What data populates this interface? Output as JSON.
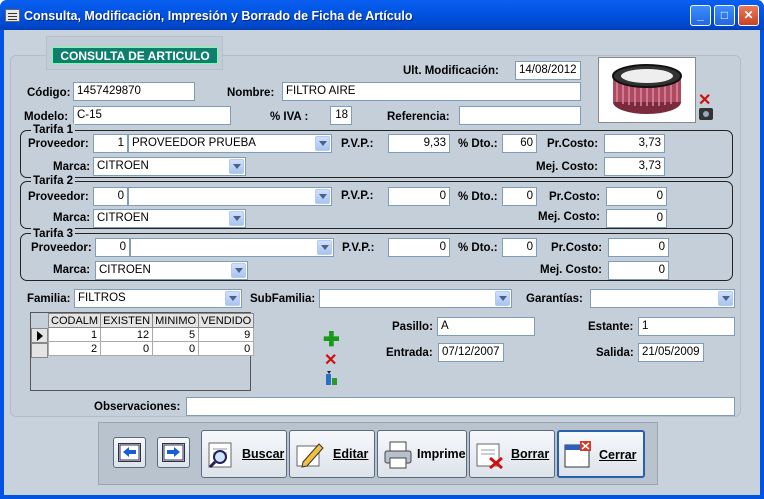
{
  "window": {
    "title": "Consulta, Modificación, Impresión y Borrado de Ficha de Artículo",
    "minimize": "_",
    "maximize": "□",
    "close": "✕"
  },
  "tab": {
    "label": "CONSULTA DE ARTICULO"
  },
  "header": {
    "ult_mod_label": "Ult. Modificación:",
    "ult_mod_value": "14/08/2012",
    "codigo_label": "Código:",
    "codigo_value": "1457429870",
    "nombre_label": "Nombre:",
    "nombre_value": "FILTRO AIRE",
    "modelo_label": "Modelo:",
    "modelo_value": "C-15",
    "iva_label": "% IVA :",
    "iva_value": "18",
    "referencia_label": "Referencia:",
    "referencia_value": ""
  },
  "labels": {
    "proveedor": "Proveedor:",
    "pvp": "P.V.P.:",
    "dto": "% Dto.:",
    "prcosto": "Pr.Costo:",
    "marca": "Marca:",
    "mejcosto": "Mej. Costo:"
  },
  "tarifas": [
    {
      "title": "Tarifa 1",
      "prov_num": "1",
      "prov_name": "PROVEEDOR PRUEBA",
      "pvp": "9,33",
      "dto": "60",
      "prcosto": "3,73",
      "marca": "CITROEN",
      "mejcosto": "3,73"
    },
    {
      "title": "Tarifa 2",
      "prov_num": "0",
      "prov_name": "",
      "pvp": "0",
      "dto": "0",
      "prcosto": "0",
      "marca": "CITROEN",
      "mejcosto": "0"
    },
    {
      "title": "Tarifa 3",
      "prov_num": "0",
      "prov_name": "",
      "pvp": "0",
      "dto": "0",
      "prcosto": "0",
      "marca": "CITROEN",
      "mejcosto": "0"
    }
  ],
  "familia": {
    "familia_label": "Familia:",
    "familia_value": "FILTROS",
    "subfamilia_label": "SubFamilia:",
    "subfamilia_value": "",
    "garantias_label": "Garantías:",
    "garantias_value": ""
  },
  "stock": {
    "columns": [
      "CODALM",
      "EXISTEN",
      "MINIMO",
      "VENDIDO"
    ],
    "rows": [
      [
        "1",
        "12",
        "5",
        "9"
      ],
      [
        "2",
        "0",
        "0",
        "0"
      ]
    ]
  },
  "ubicacion": {
    "pasillo_label": "Pasillo:",
    "pasillo_value": "A",
    "estante_label": "Estante:",
    "estante_value": "1",
    "entrada_label": "Entrada:",
    "entrada_value": "07/12/2007",
    "salida_label": "Salida:",
    "salida_value": "21/05/2009"
  },
  "observaciones": {
    "label": "Observaciones:",
    "value": ""
  },
  "buttons": {
    "buscar": "Buscar",
    "editar": "Editar",
    "imprime": "Imprime",
    "borrar": "Borrar",
    "cerrar": "Cerrar"
  },
  "colors": {
    "title_bar": "#0054e3",
    "tab_label": "#0e7f6c",
    "form_bg": "#c5cfda"
  }
}
